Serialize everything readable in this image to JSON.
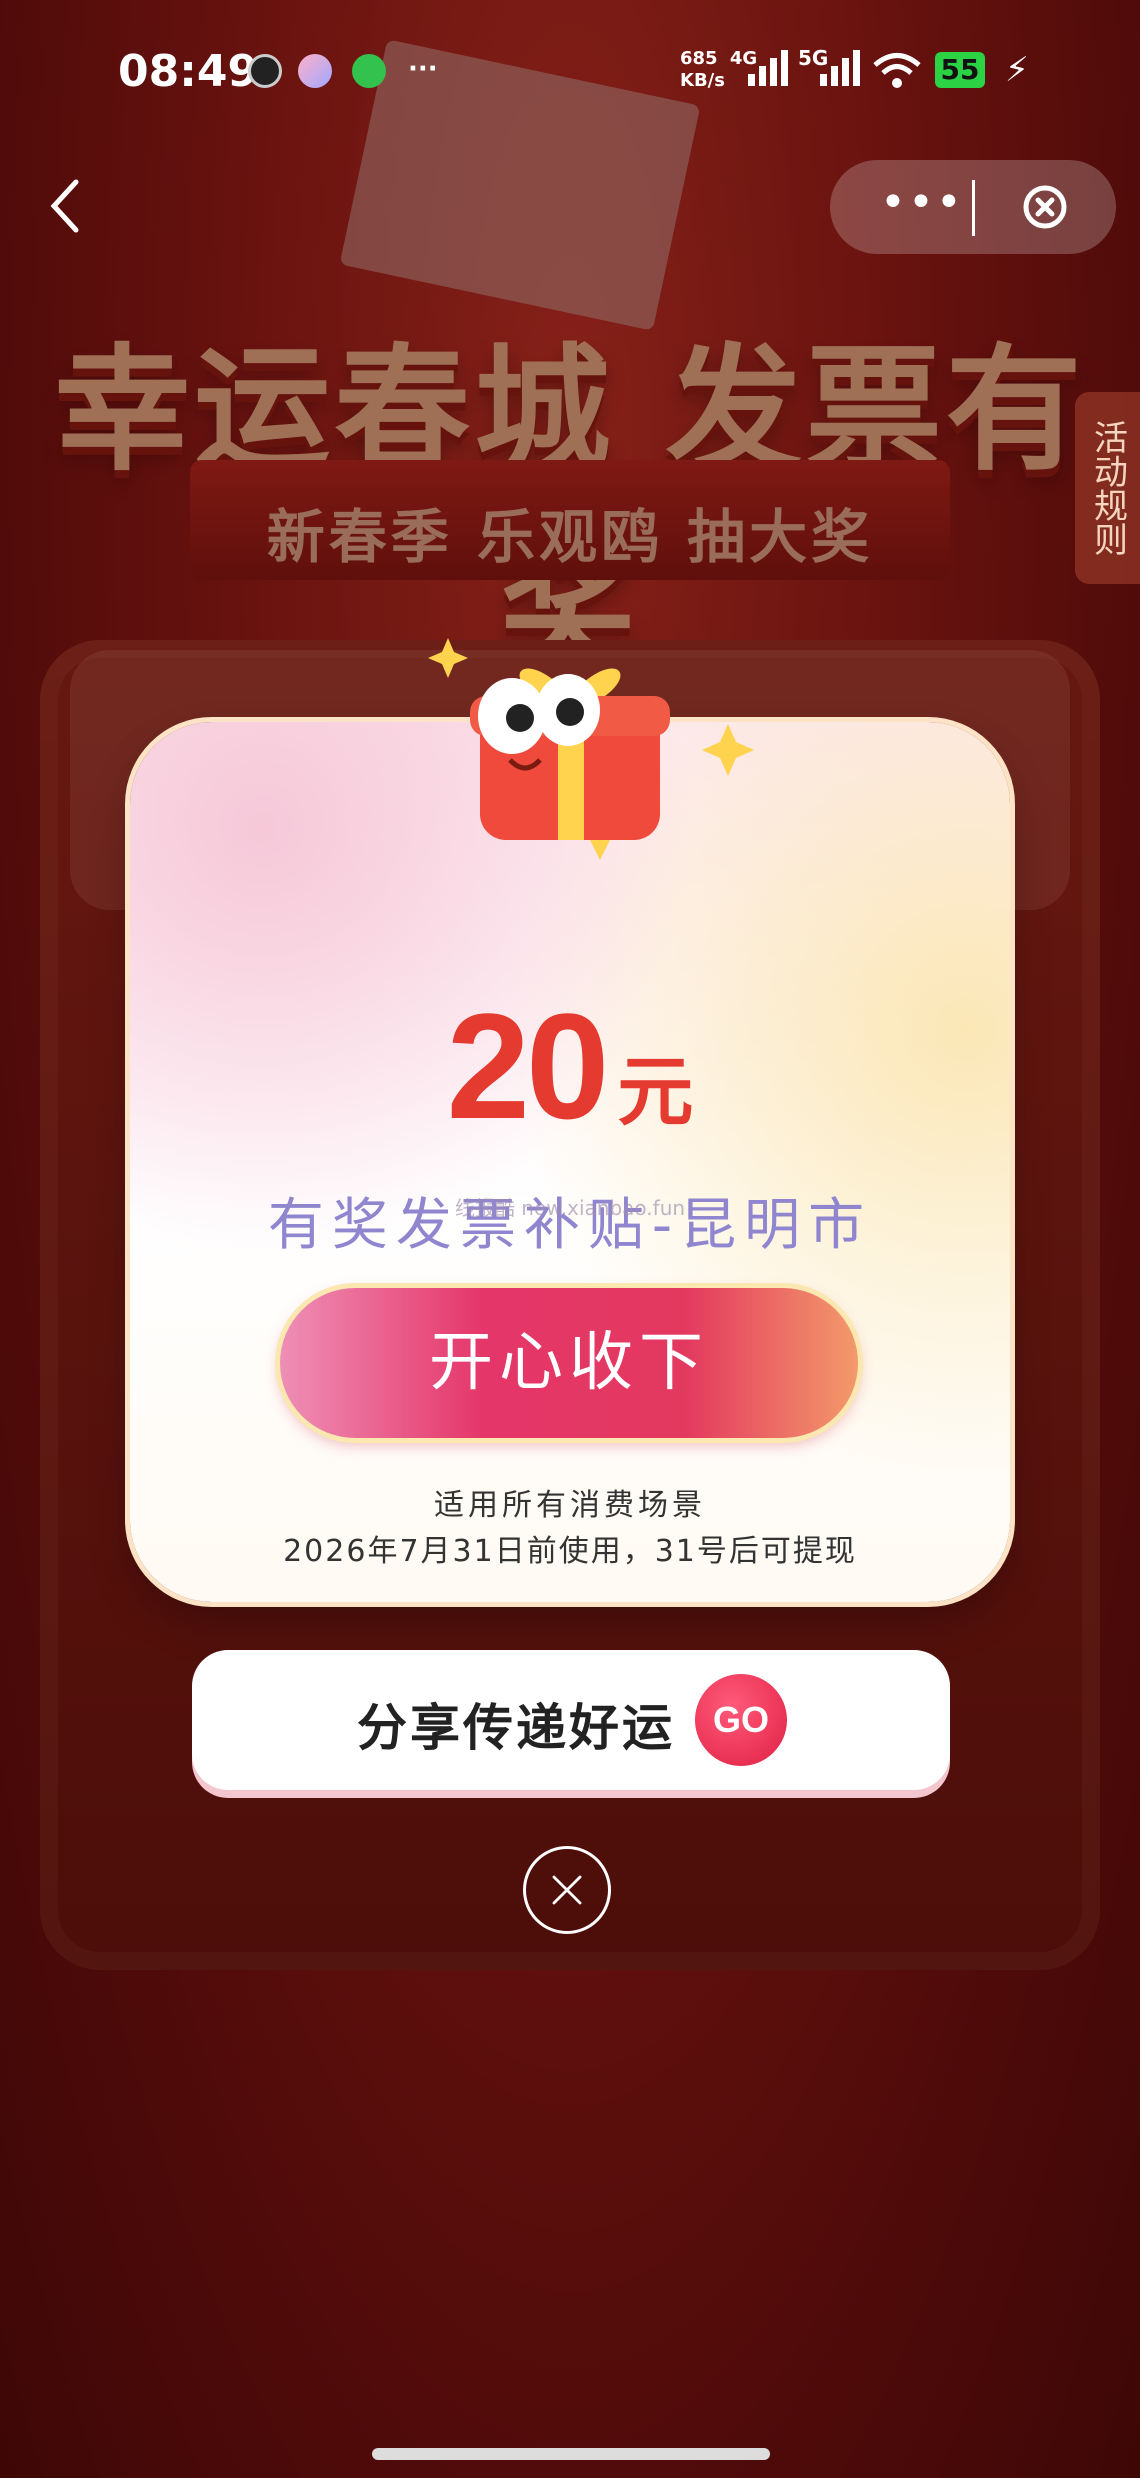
{
  "status_bar": {
    "time": "08:49",
    "net_speed": "685",
    "net_unit": "KB/s",
    "net_4g": "4G",
    "net_5g": "5G",
    "battery": "55",
    "icons": [
      "clock-icon",
      "play-icon",
      "bolt-icon",
      "more-dots-icon",
      "signal-icon",
      "wifi-icon",
      "battery-icon",
      "charging-icon"
    ]
  },
  "nav": {
    "more_icon": "•••",
    "side_rules": "活动规则"
  },
  "background": {
    "headline": "幸运春城 发票有奖",
    "ribbon": "新春季 乐观鸥 抽大奖"
  },
  "modal": {
    "amount": "20",
    "unit": "元",
    "subsidy_title": "有奖发票补贴-昆明市",
    "watermark": "线报酷 new.xianbao.fun",
    "accept_button": "开心收下",
    "note_scope": "适用所有消费场景",
    "note_expiry": "2026年7月31日前使用，31号后可提现",
    "share_text": "分享传递好运",
    "share_go": "GO"
  },
  "colors": {
    "accent_red": "#e53a2f",
    "subsidy_purple": "#8f86cf",
    "button_pink": "#e5366a",
    "battery_green": "#2bd244"
  }
}
